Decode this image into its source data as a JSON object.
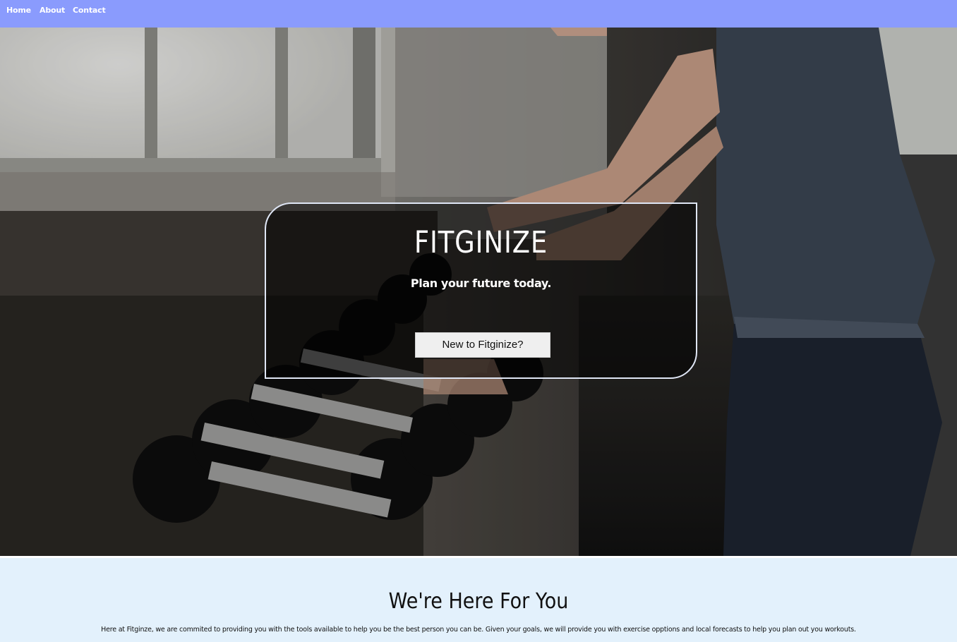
{
  "nav": {
    "home": "Home",
    "about": "About",
    "contact": "Contact"
  },
  "hero": {
    "background_image": "gym-dumbbell-rack-photo",
    "title": "FITGINIZE",
    "subtitle": "Plan your future today.",
    "cta_label": "New to Fitginize?"
  },
  "about": {
    "heading": "We're Here For You",
    "body": "Here at Fitginze, we are commited to providing you with the tools available to help you be the best person you can be. Given your goals, we will provide you with exercise opptions and local forecasts to help you plan out you workouts."
  },
  "colors": {
    "nav_bg": "#8a9bfd",
    "section_bg": "#e3f1fc",
    "card_border": "#dfe6f5",
    "button_bg": "#efefef"
  }
}
